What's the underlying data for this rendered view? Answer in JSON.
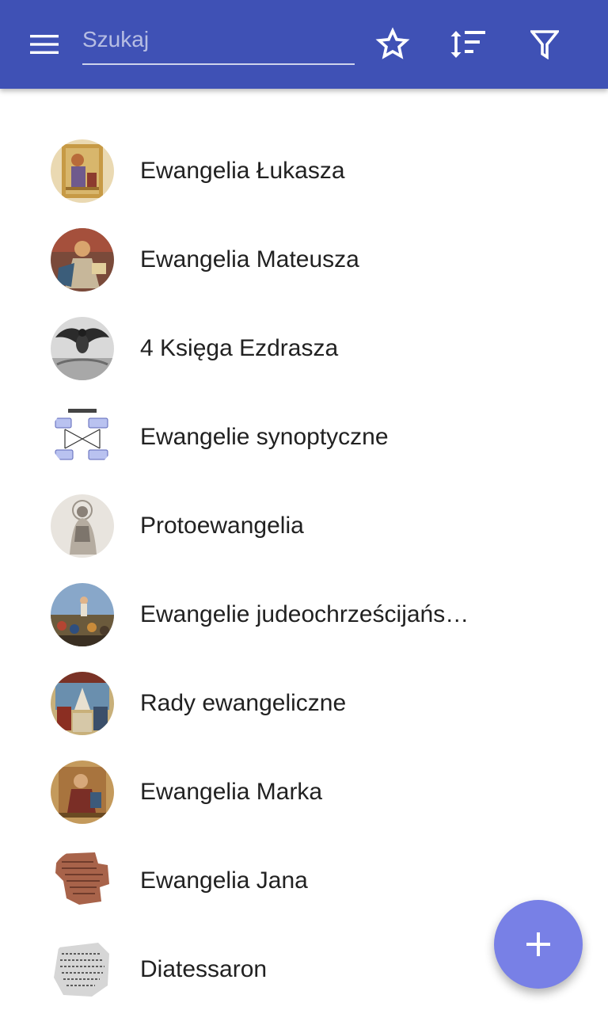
{
  "toolbar": {
    "search_placeholder": "Szukaj",
    "search_value": "",
    "menu_icon": "hamburger-menu-icon",
    "favorites_icon": "star-outline-icon",
    "sort_icon": "sort-icon",
    "filter_icon": "filter-icon"
  },
  "colors": {
    "app_bar": "#3f51b5",
    "fab": "#7880e6",
    "text_primary": "#212121"
  },
  "items": [
    {
      "label": "Ewangelia Łukasza",
      "thumbnail": "illuminated-manuscript-evangelist"
    },
    {
      "label": "Ewangelia Mateusza",
      "thumbnail": "illuminated-manuscript-matthew"
    },
    {
      "label": "4 Księga Ezdrasza",
      "thumbnail": "engraving-eagle"
    },
    {
      "label": "Ewangelie synoptyczne",
      "thumbnail": "synoptic-problem-diagram"
    },
    {
      "label": "Protoewangelia",
      "thumbnail": "engraving-madonna"
    },
    {
      "label": "Ewangelie judeochrześcijańskie",
      "thumbnail": "painting-sermon-on-the-mount"
    },
    {
      "label": "Rady ewangeliczne",
      "thumbnail": "fresco-saints"
    },
    {
      "label": "Ewangelia Marka",
      "thumbnail": "illuminated-manuscript-mark"
    },
    {
      "label": "Ewangelia Jana",
      "thumbnail": "papyrus-fragment"
    },
    {
      "label": "Diatessaron",
      "thumbnail": "manuscript-fragment"
    }
  ],
  "fab": {
    "icon": "plus-icon"
  }
}
